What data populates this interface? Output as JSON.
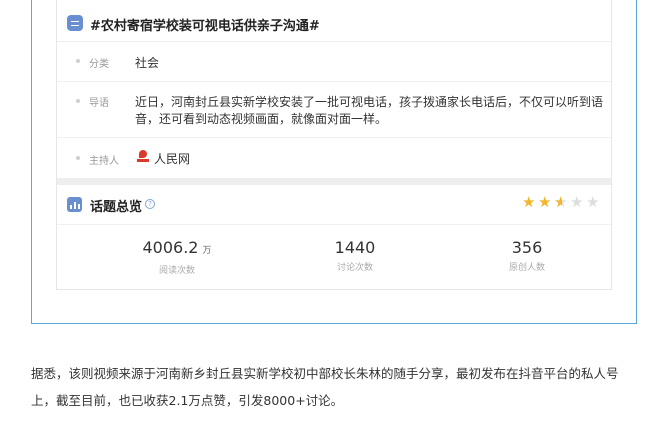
{
  "topic": {
    "title": "#农村寄宿学校装可视电话供亲子沟通#",
    "icon": "topic-list-icon"
  },
  "details": {
    "category_label": "分类",
    "category_value": "社会",
    "intro_label": "导语",
    "intro_value": "近日，河南封丘县实新学校安装了一批可视电话，孩子拨通家长电话后，不仅可以听到语音，还可看到动态视频画面，就像面对面一样。",
    "host_label": "主持人",
    "host_value": "人民网",
    "host_icon": "people-daily-logo-icon"
  },
  "overview": {
    "title": "话题总览",
    "help_glyph": "?",
    "rating_stars": 2.5,
    "rating_max": 5,
    "star_color": "#f2b52e"
  },
  "stats": [
    {
      "value": "4006.2",
      "unit": "万",
      "label": "阅读次数"
    },
    {
      "value": "1440",
      "unit": "",
      "label": "讨论次数"
    },
    {
      "value": "356",
      "unit": "",
      "label": "原创人数"
    }
  ],
  "article": {
    "text": "据悉，该则视频来源于河南新乡封丘县实新学校初中部校长朱林的随手分享，最初发布在抖音平台的私人号上，截至目前，也已收获2.1万点赞，引发8000+讨论。"
  },
  "colors": {
    "accent_border": "#5aa8d8",
    "icon_blue": "#6a8fd0"
  }
}
